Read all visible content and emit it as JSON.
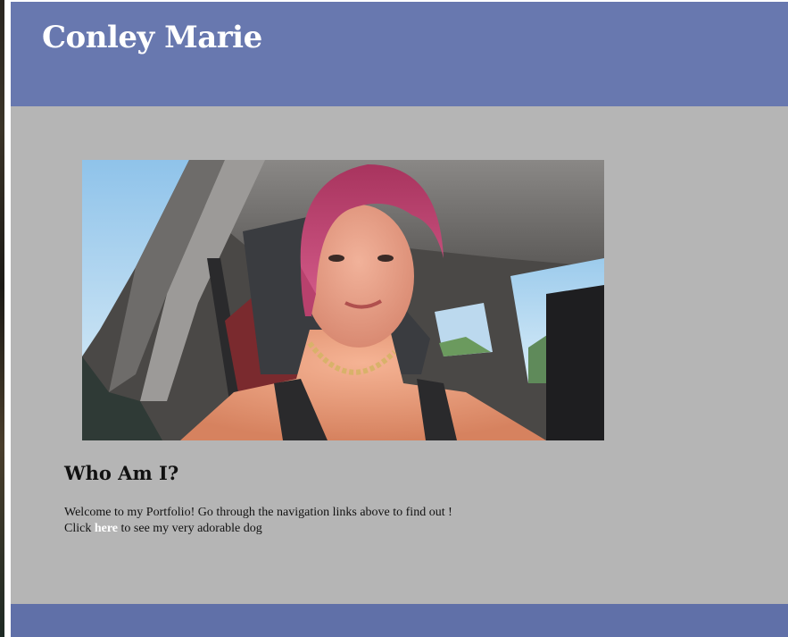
{
  "header": {
    "title": "Conley Marie"
  },
  "hero_image": {
    "description": "Selfie of a woman with pink hair wearing a gold chain necklace, seated in a car"
  },
  "about": {
    "heading": "Who Am I?",
    "line1": "Welcome to my Portfolio! Go through the navigation links above to find out !",
    "line2_prefix": "Click ",
    "link_text": "here",
    "line2_suffix": " to see my very adorable dog"
  },
  "colors": {
    "header_bg": "#6878af",
    "page_bg": "#b5b5b5",
    "footer_bg": "#6070a8",
    "link": "#ffffff"
  }
}
